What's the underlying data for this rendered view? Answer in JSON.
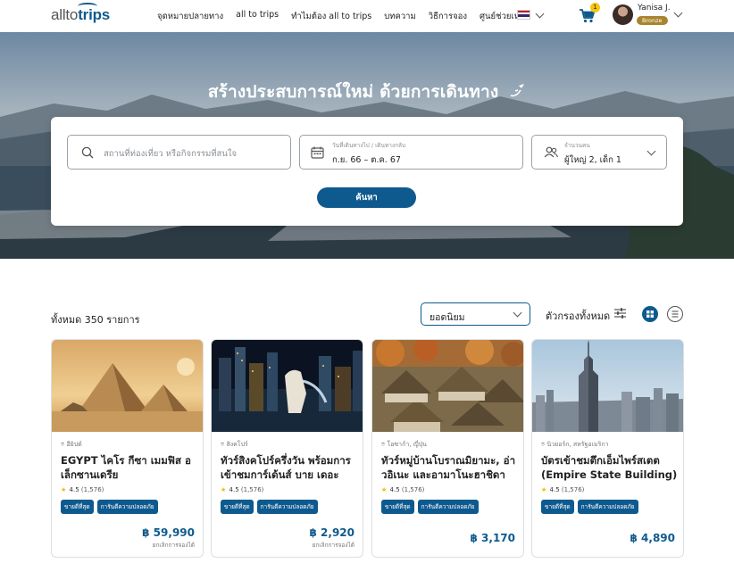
{
  "header": {
    "logo": {
      "part1": "allto",
      "part2": "trips"
    },
    "nav": [
      "จุดหมายปลายทาง",
      "all to trips",
      "ทำไมต้อง all to trips",
      "บทความ",
      "วิธีการจอง",
      "ศูนย์ช่วยเหลือ"
    ],
    "cart_count": "1",
    "user_name": "Yanisa J.",
    "user_tier": "Bronze"
  },
  "hero": {
    "title": "สร้างประสบการณ์ใหม่ ด้วยการเดินทาง",
    "search": {
      "destination_placeholder": "สถานที่ท่องเที่ยว หรือกิจกรรมที่สนใจ",
      "date_label": "วันที่เดินทางไป / เดินทางกลับ",
      "date_value": "ก.ย. 66 – ต.ค. 67",
      "guest_label": "จำนวนคน",
      "guest_value": "ผู้ใหญ่ 2, เด็ก 1",
      "button": "ค้นหา"
    }
  },
  "results": {
    "count_text": "ทั้งหมด 350 รายการ",
    "sort_value": "ยอดนิยม",
    "filter_label": "ตัวกรองทั้งหมด"
  },
  "cards": [
    {
      "location": "อียิปต์",
      "title": "EGYPT ไคโร กีซา เมมฟิส อเล็กซานเดรีย",
      "rating": "4.5",
      "reviews": "(1,576)",
      "tags": [
        "ขายดีที่สุด",
        "การันตีความปลอดภัย"
      ],
      "price": "฿ 59,990",
      "note": "ยกเลิกการจองได้"
    },
    {
      "location": "สิงคโปร์",
      "title": "ทัวร์สิงคโปร์ครึ่งวัน พร้อมการเข้าชมการ์เด้นส์ บาย เดอะ เบย์",
      "rating": "4.5",
      "reviews": "(1,576)",
      "tags": [
        "ขายดีที่สุด",
        "การันตีความปลอดภัย"
      ],
      "price": "฿ 2,920",
      "note": "ยกเลิกการจองได้"
    },
    {
      "location": "โอซาก้า, ญี่ปุ่น",
      "title": "ทัวร์หมู่บ้านโบราณมิยามะ, อ่าวอิเนะ และอามาโนะฮาชิดาเตะ",
      "rating": "4.5",
      "reviews": "(1,576)",
      "tags": [
        "ขายดีที่สุด",
        "การันตีความปลอดภัย"
      ],
      "price": "฿ 3,170",
      "note": ""
    },
    {
      "location": "นิวยอร์ก, สหรัฐอเมริกา",
      "title": "บัตรเข้าชมตึกเอ็มไพร์สเตต (Empire State Building) ในนิวยอร์ก",
      "rating": "4.5",
      "reviews": "(1,576)",
      "tags": [
        "ขายดีที่สุด",
        "การันตีความปลอดภัย"
      ],
      "price": "฿ 4,890",
      "note": ""
    }
  ]
}
